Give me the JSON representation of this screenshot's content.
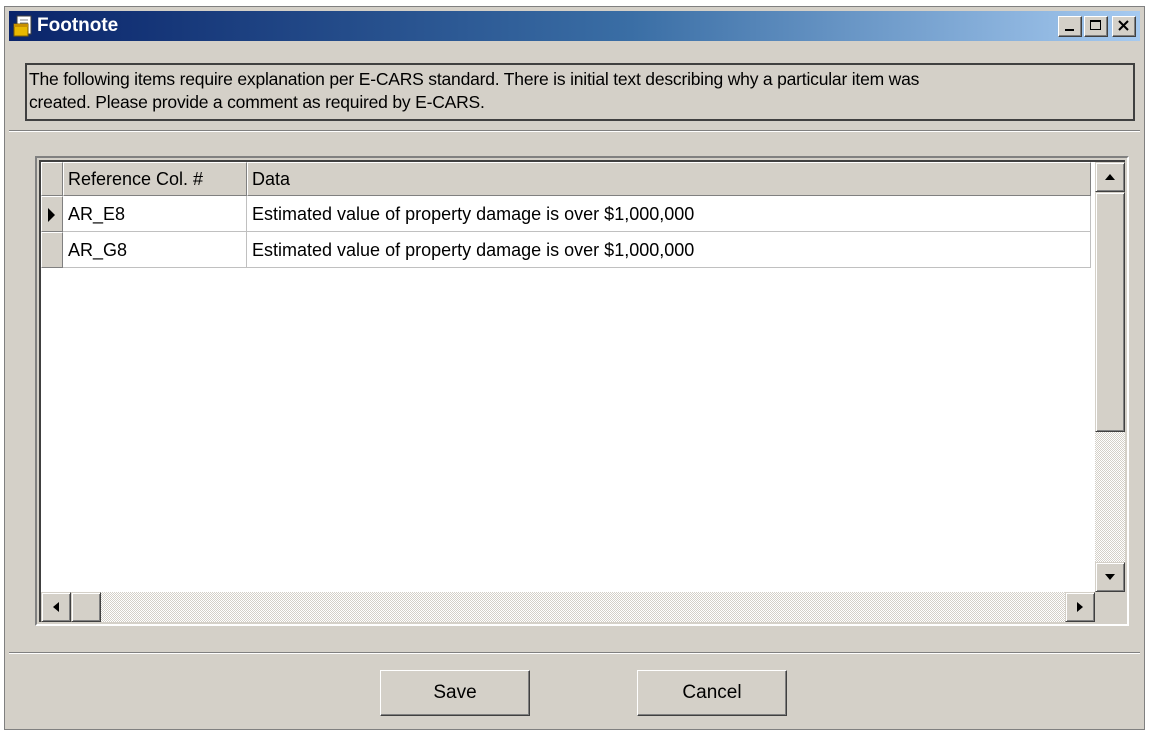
{
  "window": {
    "title": "Footnote",
    "icon": "notebook-icon",
    "controls": [
      "minimize-icon",
      "maximize-icon",
      "close-icon"
    ]
  },
  "info": {
    "line1": "The following items require explanation per E-CARS standard.  There is initial text describing why a particular item was",
    "line2": "created.  Please provide a comment as required by E-CARS."
  },
  "grid": {
    "columns": [
      "Reference Col. #",
      "Data"
    ],
    "rows": [
      {
        "reference": "AR_E8",
        "data": "Estimated value of property damage is over $1,000,000",
        "current": true
      },
      {
        "reference": "AR_G8",
        "data": "Estimated value of property damage is over $1,000,000",
        "current": false
      }
    ]
  },
  "buttons": {
    "save_label": "Save",
    "cancel_label": "Cancel"
  },
  "colors": {
    "title_start": "#0a246a",
    "title_end": "#a6caf0",
    "face": "#d4d0c8"
  }
}
